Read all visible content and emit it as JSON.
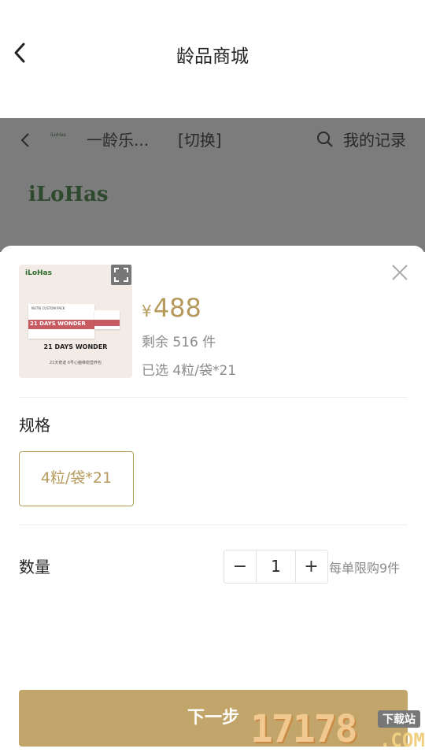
{
  "nav": {
    "title": "龄品商城"
  },
  "background_page": {
    "shop_name": "一龄乐...",
    "switch_label": "[切换]",
    "records_label": "我的记录",
    "brand_logo_text": "iLoHas",
    "mini_logo_text": "iLoHas"
  },
  "product": {
    "thumb_logo": "iLoHas",
    "thumb_box_header": "NUTRI CUSTOM PACK",
    "thumb_box_band": "21 DAYS WONDER",
    "thumb_title": "21 DAYS WONDER",
    "thumb_subtitle": "21天奇迹 6号心脑维稳营养包",
    "currency": "¥",
    "price": "488",
    "stock_text": "剩余  516  件",
    "selected_text": "已选  4粒/袋*21"
  },
  "spec": {
    "title": "规格",
    "options": [
      "4粒/袋*21"
    ]
  },
  "quantity": {
    "title": "数量",
    "minus": "−",
    "value": "1",
    "plus": "+",
    "limit_text": "每单限购9件"
  },
  "actions": {
    "next_label": "下一步"
  },
  "watermark": {
    "number": "17178",
    "download": "下载站",
    "domain": ".COM"
  },
  "colors": {
    "accent": "#b59a5c",
    "button": "#c2a56a",
    "overlay": "#7c7c7c"
  },
  "icons": [
    "back-arrow-icon",
    "search-icon",
    "expand-icon",
    "close-icon"
  ]
}
